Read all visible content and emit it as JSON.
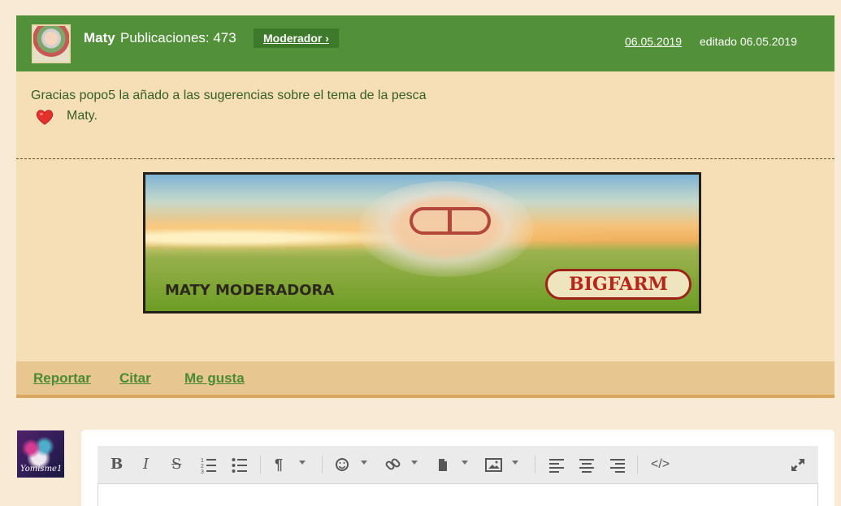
{
  "post": {
    "author": "Maty",
    "posts_text": "Publicaciones: 473",
    "role": "Moderador ›",
    "date": "06.05.2019",
    "edited": "editado 06.05.2019",
    "message": "Gracias popo5  la  añado a las sugerencias sobre el  tema de la pesca",
    "signoff": "Maty.",
    "banner": {
      "title": "MATY MODERADORA",
      "logo": "BIGFARM"
    },
    "actions": [
      {
        "label": "Reportar"
      },
      {
        "label": "Citar"
      },
      {
        "label": "Me gusta"
      }
    ],
    "heart_icon": "heart-icon"
  },
  "reply": {
    "avatar_text": "Yomisme1",
    "toolbar_icons": [
      "bold-icon",
      "italic-icon",
      "strikethrough-icon",
      "numbered-list-icon",
      "bulleted-list-icon",
      "paragraph-format-icon",
      "emoji-icon",
      "link-icon",
      "insert-file-icon",
      "insert-image-icon",
      "align-left-icon",
      "align-center-icon",
      "align-right-icon",
      "code-view-icon",
      "fullscreen-icon"
    ]
  },
  "colors": {
    "header_green": "#53903a",
    "post_background": "#f6dfb6",
    "page_background": "#f8ead4",
    "link_green": "#4b8a34"
  }
}
